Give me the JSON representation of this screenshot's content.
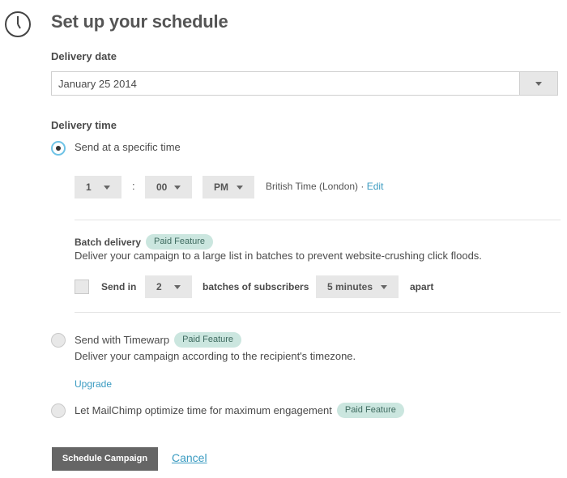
{
  "page": {
    "title": "Set up your schedule"
  },
  "icons": {
    "header": "clock-icon"
  },
  "delivery_date": {
    "label": "Delivery date",
    "value": "January 25 2014"
  },
  "delivery_time": {
    "label": "Delivery time",
    "specific_time": {
      "label": "Send at a specific time",
      "selected": true,
      "hour": "1",
      "separator": ":",
      "minute": "00",
      "meridiem": "PM",
      "timezone": "British Time (London)",
      "timezone_sep": "·",
      "edit_label": "Edit"
    },
    "batch": {
      "title": "Batch delivery",
      "badge": "Paid Feature",
      "description": "Deliver your campaign to a large list in batches to prevent website-crushing click floods.",
      "send_in_label": "Send in",
      "batches_value": "2",
      "batches_label": "batches of subscribers",
      "interval_value": "5 minutes",
      "apart_label": "apart"
    },
    "timewarp": {
      "label": "Send with Timewarp",
      "badge": "Paid Feature",
      "description": "Deliver your campaign according to the recipient's timezone.",
      "upgrade_label": "Upgrade"
    },
    "optimize": {
      "label": "Let MailChimp optimize time for maximum engagement",
      "badge": "Paid Feature"
    }
  },
  "actions": {
    "schedule_label": "Schedule Campaign",
    "cancel_label": "Cancel"
  },
  "colors": {
    "accent_link": "#3a9bc1",
    "radio_selected": "#6ec3e6",
    "badge_bg": "#cbe6df",
    "button_bg": "#666666"
  }
}
